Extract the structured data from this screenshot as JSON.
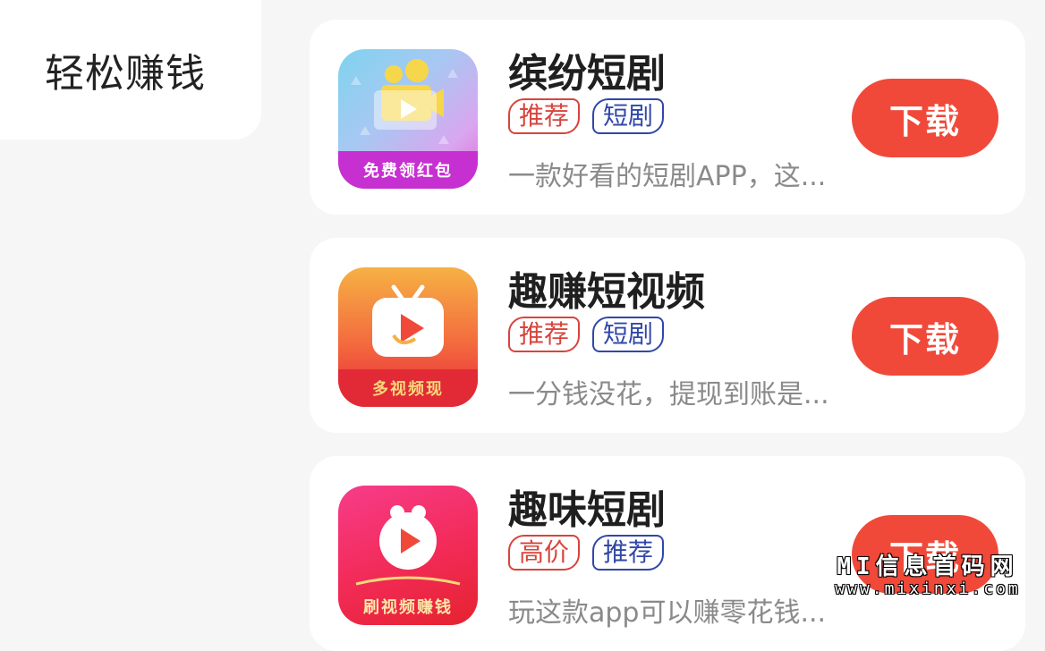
{
  "sidebar": {
    "active_tab_label": "轻松赚钱"
  },
  "apps": [
    {
      "name": "缤纷短剧",
      "tags": [
        "推荐",
        "短剧"
      ],
      "description": "一款好看的短剧APP，这...",
      "download_label": "下载",
      "icon_banner": "免费领红包"
    },
    {
      "name": "趣赚短视频",
      "tags": [
        "推荐",
        "短剧"
      ],
      "description": "一分钱没花，提现到账是...",
      "download_label": "下载",
      "icon_banner": "多视频现"
    },
    {
      "name": "趣味短剧",
      "tags": [
        "高价",
        "推荐"
      ],
      "description": "玩这款app可以赚零花钱...",
      "download_label": "下载",
      "icon_banner": "刷视频赚钱"
    }
  ],
  "watermark": {
    "title": "MI信息首码网",
    "url": "www.mixinxi.com"
  },
  "colors": {
    "accent": "#f0493a",
    "tag_red": "#d8443c",
    "tag_blue": "#3147a8",
    "background": "#f6f6f6"
  }
}
